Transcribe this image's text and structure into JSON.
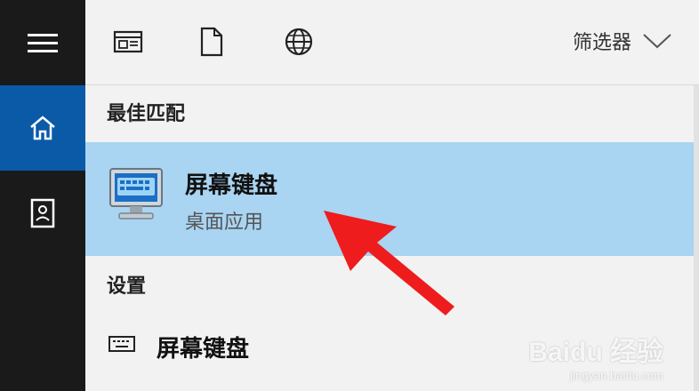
{
  "rail": {
    "menu_icon": "hamburger-icon",
    "home_icon": "home-icon",
    "notebook_icon": "notebook-icon"
  },
  "topbar": {
    "icons": [
      "apps-filter-icon",
      "documents-filter-icon",
      "web-filter-icon"
    ],
    "filter_label": "筛选器"
  },
  "best_match": {
    "section_title": "最佳匹配",
    "app_name": "屏幕键盘",
    "app_type": "桌面应用"
  },
  "settings": {
    "section_title": "设置",
    "item_label": "屏幕键盘"
  },
  "watermark": {
    "brand": "Baidu 经验",
    "url": "jingyan.baidu.com"
  },
  "colors": {
    "rail_bg": "#1a1a1a",
    "rail_selected": "#0a5aa8",
    "highlight_bg": "#a9d4f2",
    "annotation_arrow": "#ee1c1c"
  }
}
